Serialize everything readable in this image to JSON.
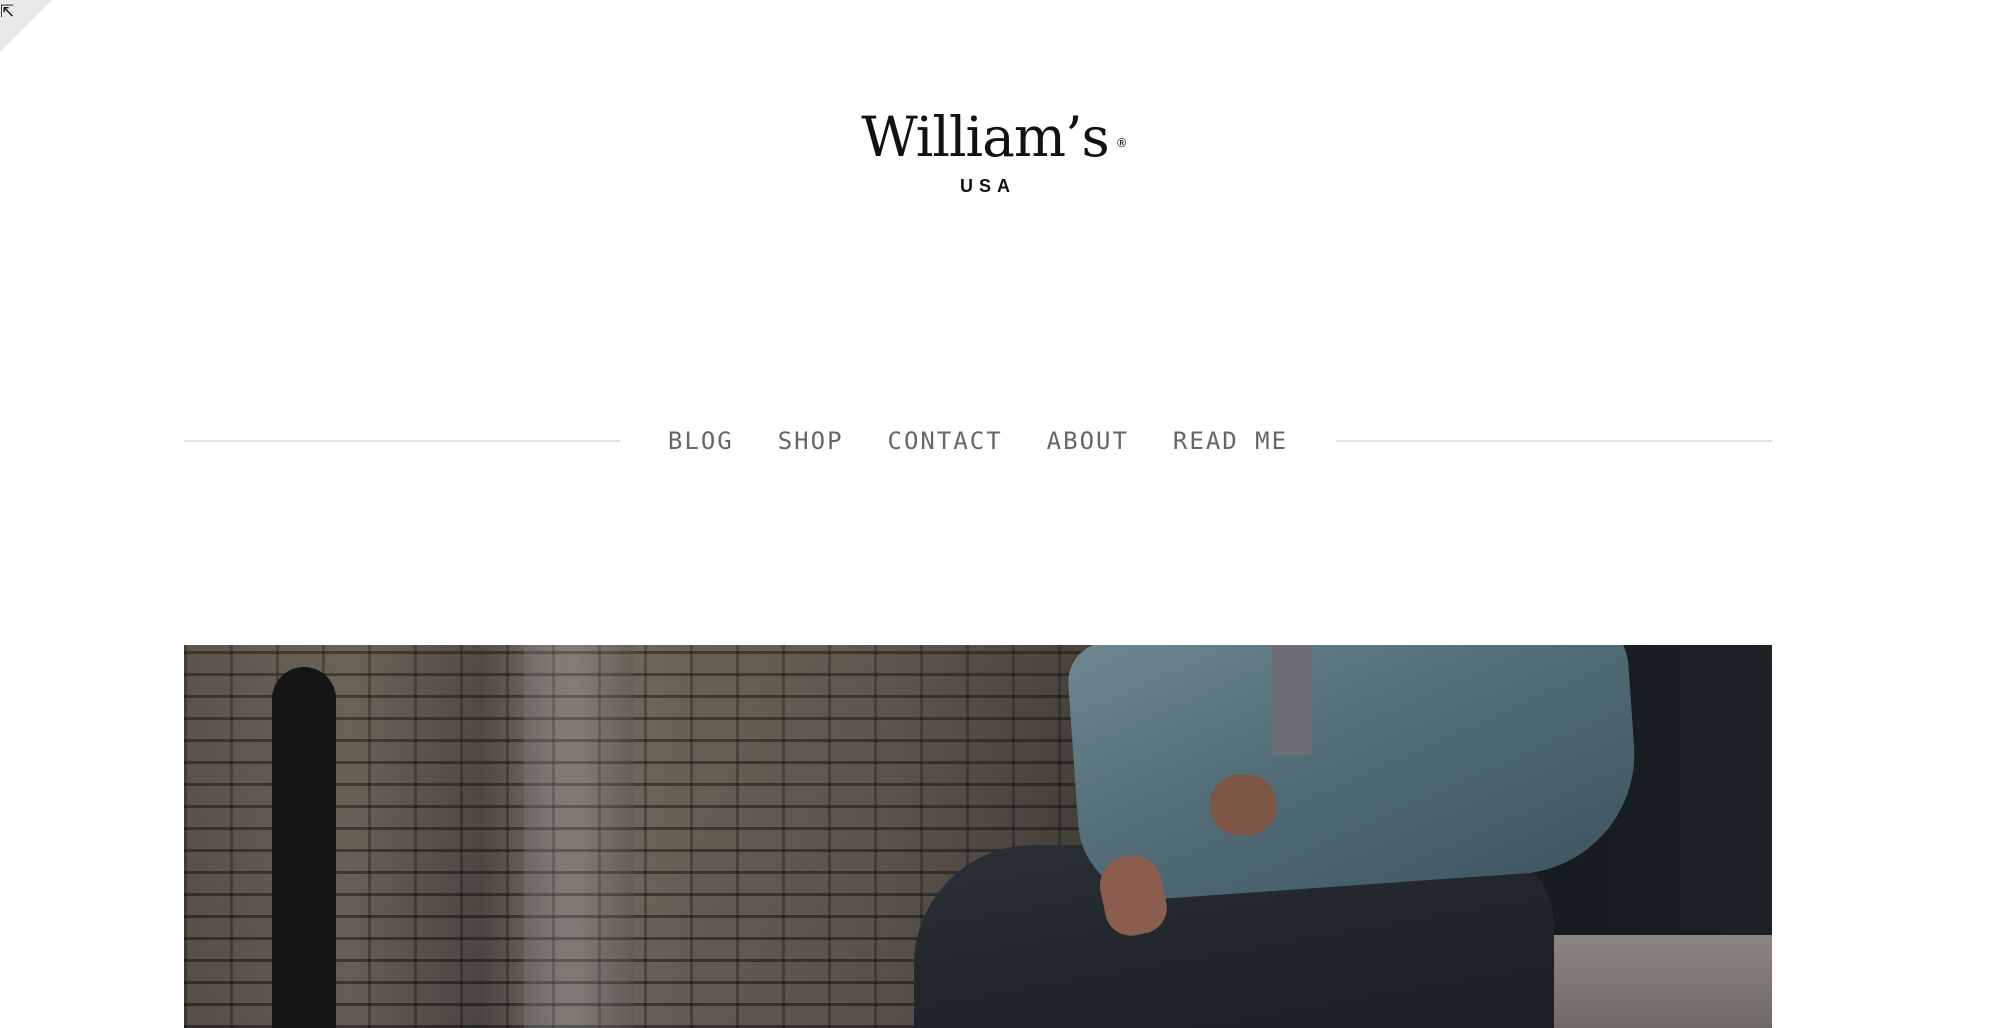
{
  "brand": {
    "wordmark": "William’s",
    "registered_mark": "®",
    "subtitle": "USA"
  },
  "nav": {
    "items": [
      {
        "label": "BLOG"
      },
      {
        "label": "SHOP"
      },
      {
        "label": "CONTACT"
      },
      {
        "label": "ABOUT"
      },
      {
        "label": "READ ME"
      }
    ]
  },
  "corner": {
    "arrow_glyph": "⇱"
  },
  "icons": {
    "corner": "resize-arrow-icon"
  },
  "colors": {
    "nav_text": "#666666",
    "divider": "#e2e2e2",
    "logo": "#111111",
    "background": "#ffffff"
  }
}
